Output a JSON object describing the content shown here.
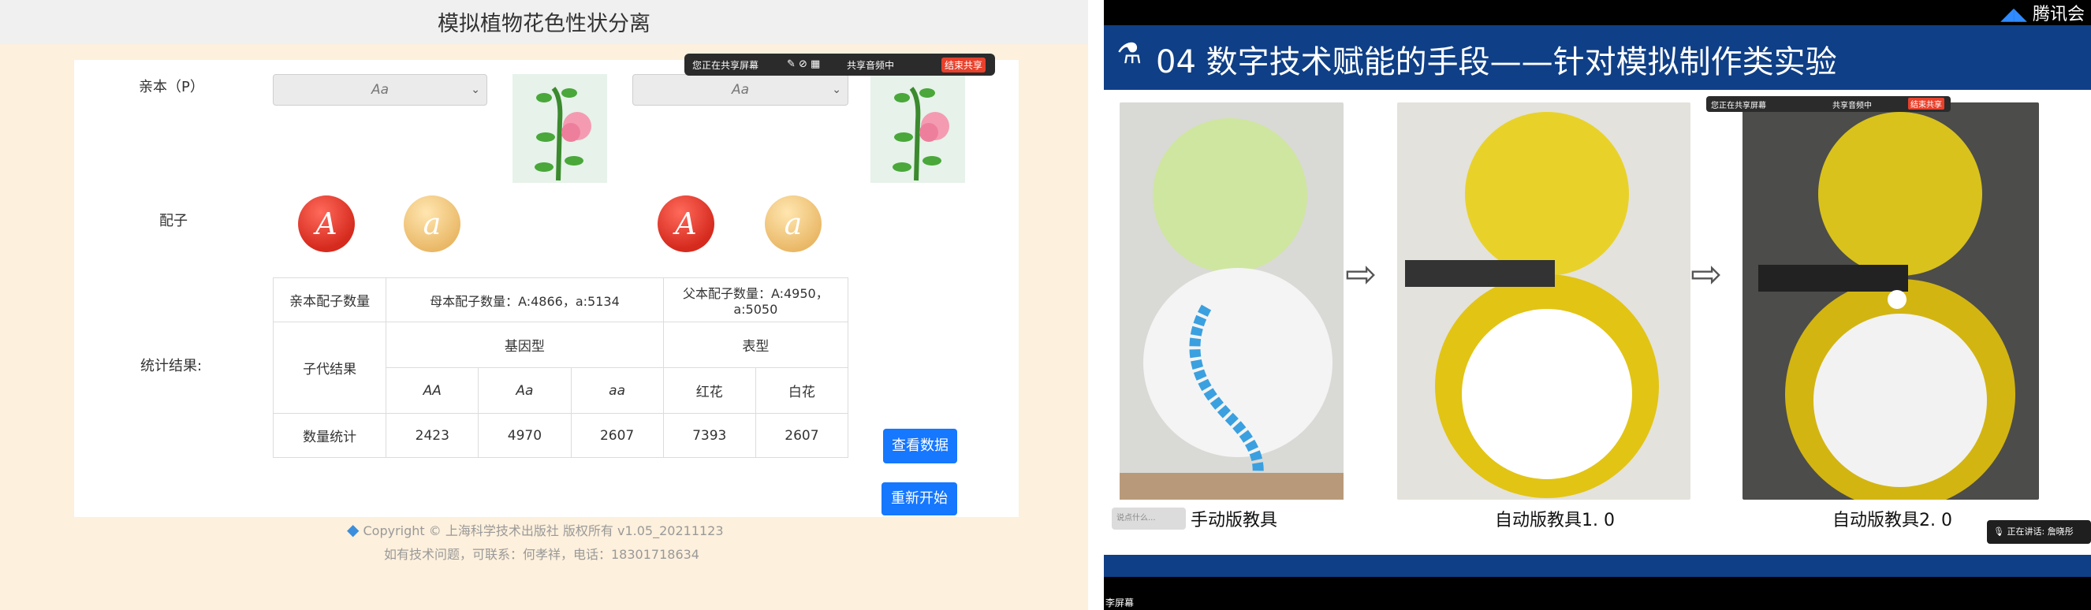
{
  "left": {
    "title": "模拟植物花色性状分离",
    "parent_label": "亲本（P）",
    "parent_select_1": "Aa",
    "parent_select_2": "Aa",
    "gamete_label": "配子",
    "gametes": [
      "A",
      "a",
      "A",
      "a"
    ],
    "stats_label": "统计结果:",
    "table": {
      "parent_gamete_count_label": "亲本配子数量",
      "mother_gamete_count": "母本配子数量：A:4866，a:5134",
      "father_gamete_count": "父本配子数量：A:4950，a:5050",
      "offspring_label": "子代结果",
      "genotype_label": "基因型",
      "phenotype_label": "表型",
      "columns": [
        "AA",
        "Aa",
        "aa",
        "红花",
        "白花"
      ],
      "count_label": "数量统计",
      "counts": [
        "2423",
        "4970",
        "2607",
        "7393",
        "2607"
      ]
    },
    "view_data_button": "查看数据",
    "restart_button": "重新开始",
    "footer_copyright": "Copyright © 上海科学技术出版社 版权所有   v1.05_20211123",
    "footer_contact": "如有技术问题，可联系：何孝祥，电话：18301718634",
    "share_bar": {
      "sharing_text": "您正在共享屏幕",
      "audio_text": "共享音频中",
      "end_button": "结束共享"
    }
  },
  "right": {
    "slide_title": "04 数字技术赋能的手段——针对模拟制作类实验",
    "brand": "腾讯会",
    "captions": [
      "手动版教具",
      "自动版教具1. 0",
      "自动版教具2. 0"
    ],
    "share_bar": {
      "sharing_text": "您正在共享屏幕",
      "audio_text": "共享音频中",
      "end_button": "结束共享"
    },
    "comment_placeholder": "说点什么...",
    "speaking_label": "正在讲话:",
    "speaker_name": "詹晓彤",
    "bottom_label": "李屏幕"
  },
  "colors": {
    "slide_blue": "#0f3f86",
    "button_blue": "#1677ff",
    "gamete_dominant": "#d52a1e",
    "gamete_recessive": "#e9b765",
    "left_bg": "#fdf0dc"
  }
}
